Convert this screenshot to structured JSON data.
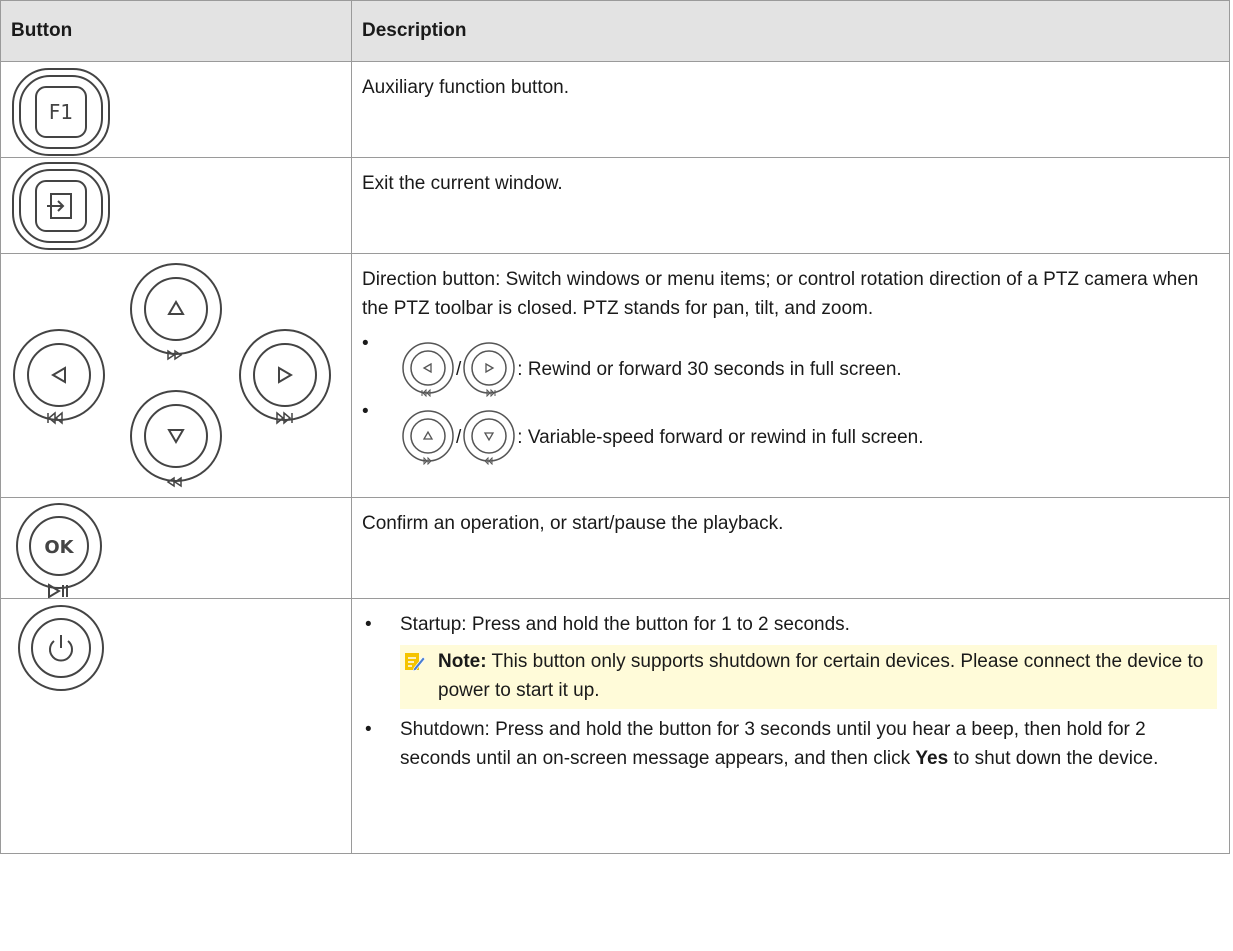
{
  "header": {
    "button": "Button",
    "description": "Description"
  },
  "rows": {
    "f1": {
      "key_label": "F1",
      "text": "Auxiliary function button."
    },
    "exit": {
      "text": "Exit the current window."
    },
    "direction": {
      "text": "Direction button: Switch windows or menu items; or control rotation direction of a PTZ camera when the PTZ toolbar is closed. PTZ stands for pan, tilt, and zoom.",
      "bullet1": ": Rewind or forward 30 seconds in full screen.",
      "bullet2": ": Variable-speed forward or rewind in full screen.",
      "slash": "/",
      "bullet_mark": "•"
    },
    "ok": {
      "key_label": "OK",
      "text": "Confirm an operation, or start/pause the playback."
    },
    "power": {
      "startup": "Startup: Press and hold the button for 1 to 2 seconds.",
      "note_label": "Note:",
      "note_text": " This button only supports shutdown for certain devices. Please connect the device to power to start it up.",
      "shutdown_pre": "Shutdown: Press and hold the button for 3 seconds until you hear a beep, then hold for 2 seconds until an on-screen message appears, and then click ",
      "shutdown_bold": "Yes",
      "shutdown_post": " to shut down the device.",
      "bullet_mark": "•"
    }
  }
}
